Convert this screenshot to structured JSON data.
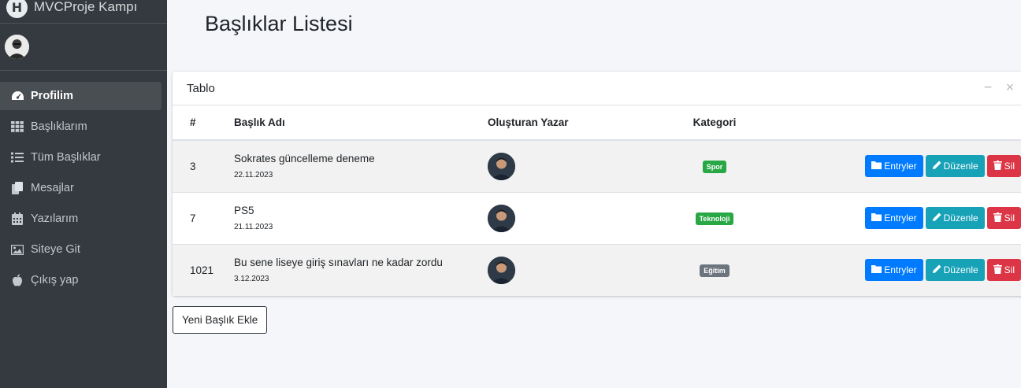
{
  "brand": {
    "text": "MVCProje Kampı",
    "logo_letter": "H"
  },
  "sidebar": {
    "items": [
      {
        "label": "Profilim",
        "icon": "dashboard-icon",
        "active": true
      },
      {
        "label": "Başlıklarım",
        "icon": "grid-icon"
      },
      {
        "label": "Tüm Başlıklar",
        "icon": "list-icon"
      },
      {
        "label": "Mesajlar",
        "icon": "copy-icon"
      },
      {
        "label": "Yazılarım",
        "icon": "calendar-icon"
      },
      {
        "label": "Siteye Git",
        "icon": "image-icon"
      },
      {
        "label": "Çıkış yap",
        "icon": "apple-icon"
      }
    ]
  },
  "page": {
    "title": "Başlıklar Listesi"
  },
  "card": {
    "title": "Tablo",
    "minimize_symbol": "−",
    "close_symbol": "×"
  },
  "table": {
    "headers": {
      "num": "#",
      "title": "Başlık Adı",
      "author": "Oluşturan Yazar",
      "category": "Kategori"
    },
    "rows": [
      {
        "id": "3",
        "title": "Sokrates güncelleme deneme",
        "date": "22.11.2023",
        "category": "Spor",
        "category_color": "#28a745"
      },
      {
        "id": "7",
        "title": "PS5",
        "date": "21.11.2023",
        "category": "Teknoloji",
        "category_color": "#28a745"
      },
      {
        "id": "1021",
        "title": "Bu sene liseye giriş sınavları ne kadar zordu",
        "date": "3.12.2023",
        "category": "Eğitim",
        "category_color": "#6c757d"
      }
    ],
    "actions": {
      "entries": "Entryler",
      "edit": "Düzenle",
      "delete": "Sil"
    }
  },
  "add_button": {
    "label": "Yeni Başlık Ekle"
  },
  "colors": {
    "sidebar_bg": "#343a40",
    "primary": "#007bff",
    "info": "#17a2b8",
    "danger": "#dc3545",
    "success": "#28a745",
    "secondary": "#6c757d"
  }
}
